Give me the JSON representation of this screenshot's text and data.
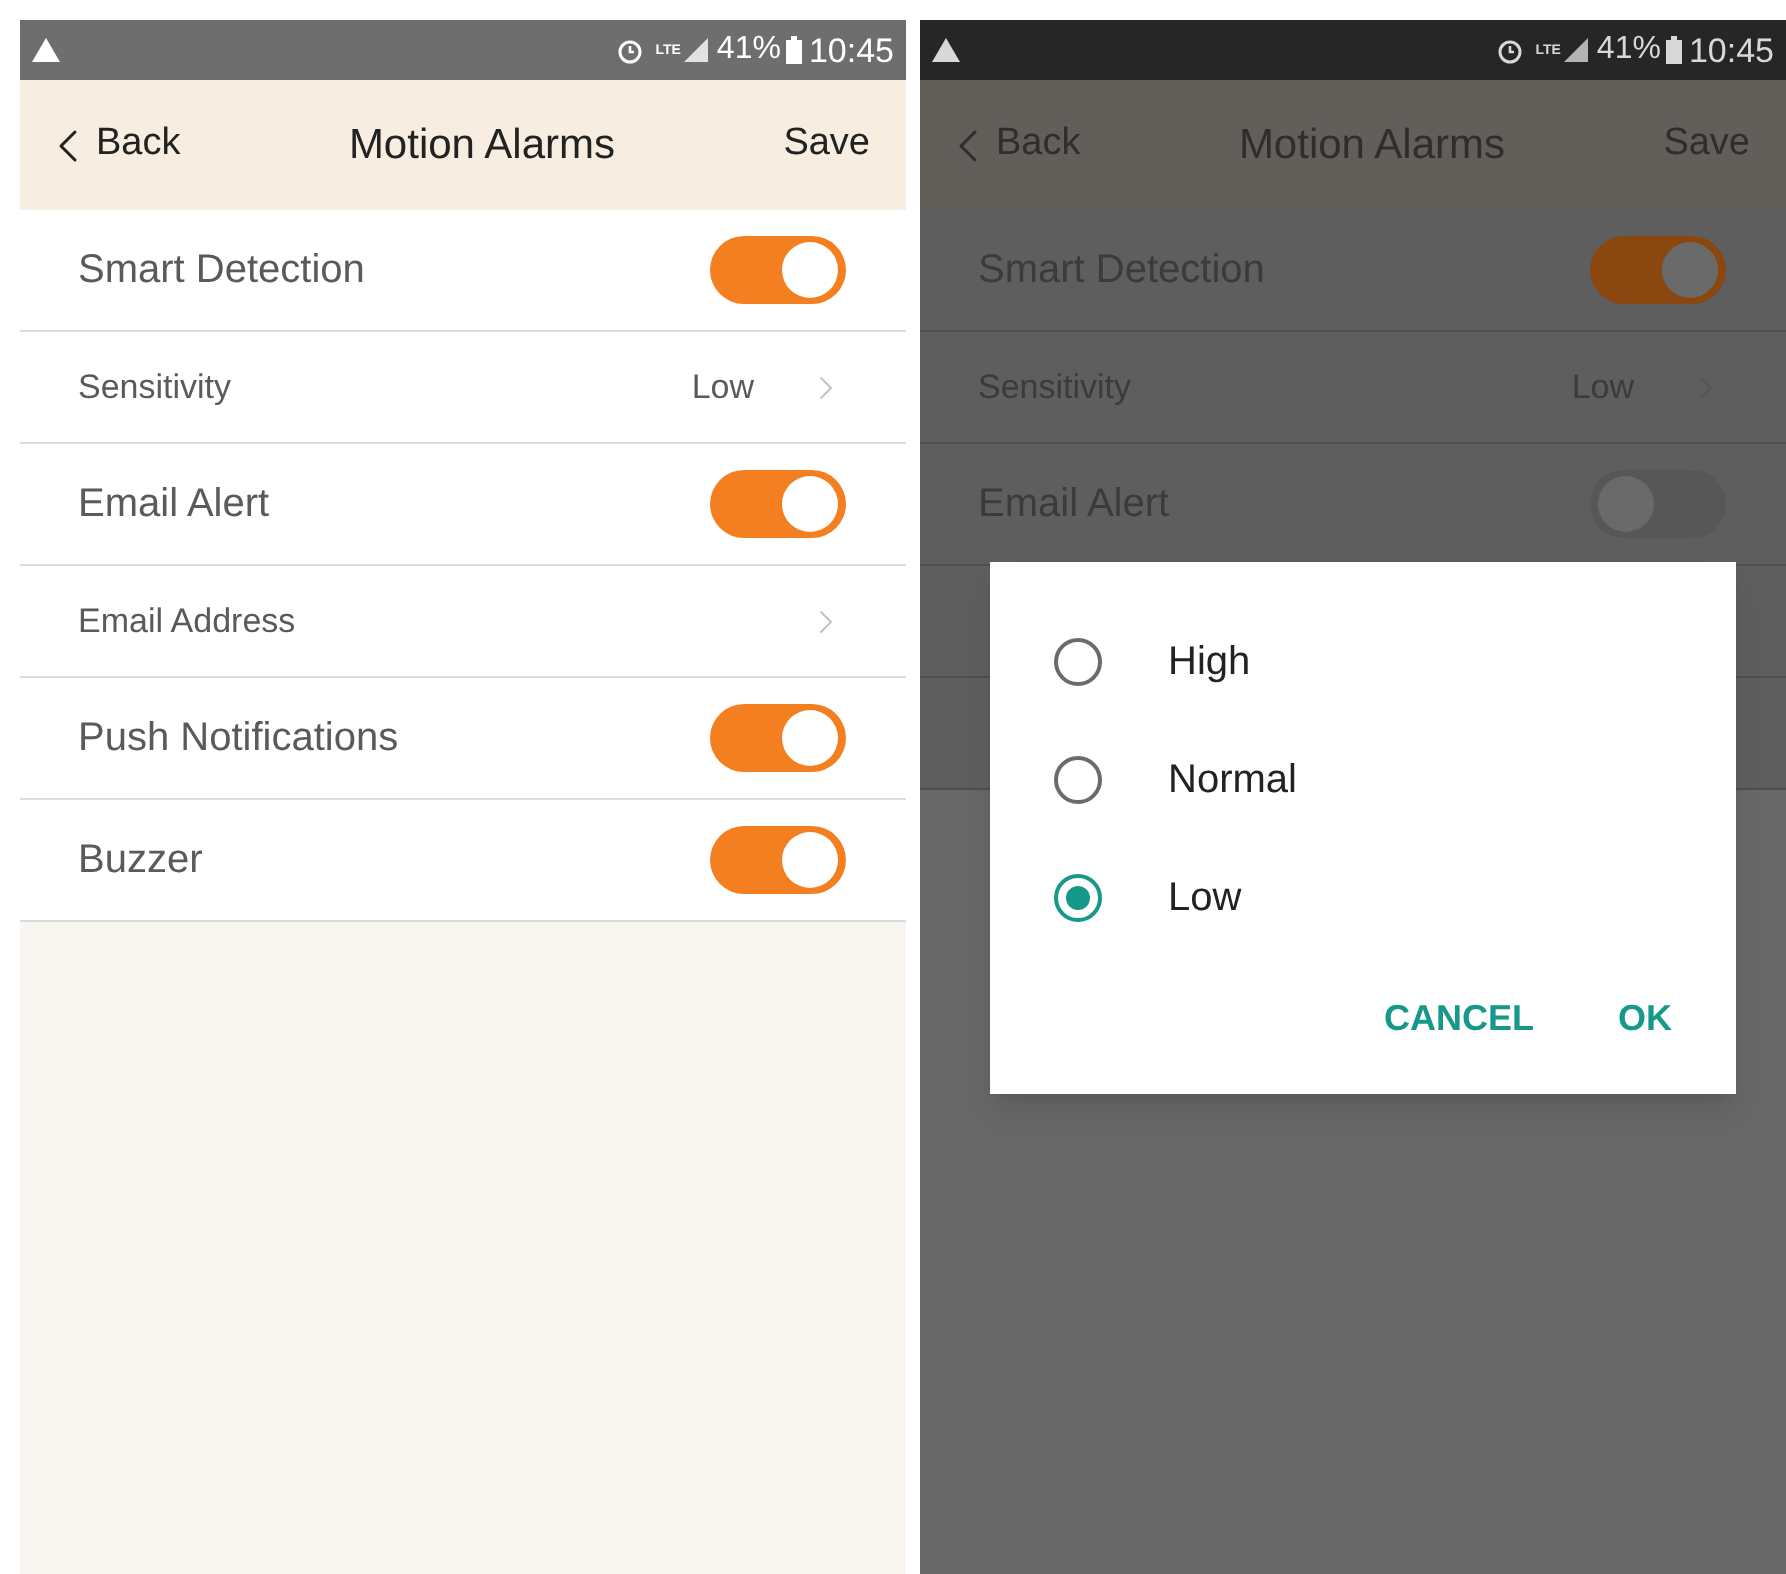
{
  "screens": [
    {
      "dimmed": false,
      "status_bar": {
        "network": "LTE",
        "battery": "41%",
        "time": "10:45"
      },
      "header": {
        "back": "Back",
        "title": "Motion Alarms",
        "save": "Save"
      },
      "rows": [
        {
          "kind": "toggle",
          "label": "Smart Detection",
          "on": true
        },
        {
          "kind": "link",
          "label": "Sensitivity",
          "value": "Low"
        },
        {
          "kind": "toggle",
          "label": "Email Alert",
          "on": true
        },
        {
          "kind": "link",
          "label": "Email Address"
        },
        {
          "kind": "toggle",
          "label": "Push Notifications",
          "on": true
        },
        {
          "kind": "toggle",
          "label": "Buzzer",
          "on": true
        }
      ]
    },
    {
      "dimmed": true,
      "status_bar": {
        "network": "LTE",
        "battery": "41%",
        "time": "10:45"
      },
      "header": {
        "back": "Back",
        "title": "Motion Alarms",
        "save": "Save"
      },
      "rows": [
        {
          "kind": "toggle",
          "label": "Smart Detection",
          "on": true
        },
        {
          "kind": "link",
          "label": "Sensitivity",
          "value": "Low"
        },
        {
          "kind": "toggle",
          "label": "Email Alert",
          "on": false
        },
        {
          "kind": "covered"
        },
        {
          "kind": "covered"
        }
      ],
      "dialog": {
        "options": [
          {
            "label": "High",
            "selected": false
          },
          {
            "label": "Normal",
            "selected": false
          },
          {
            "label": "Low",
            "selected": true
          }
        ],
        "buttons": [
          "CANCEL",
          "OK"
        ]
      }
    }
  ]
}
